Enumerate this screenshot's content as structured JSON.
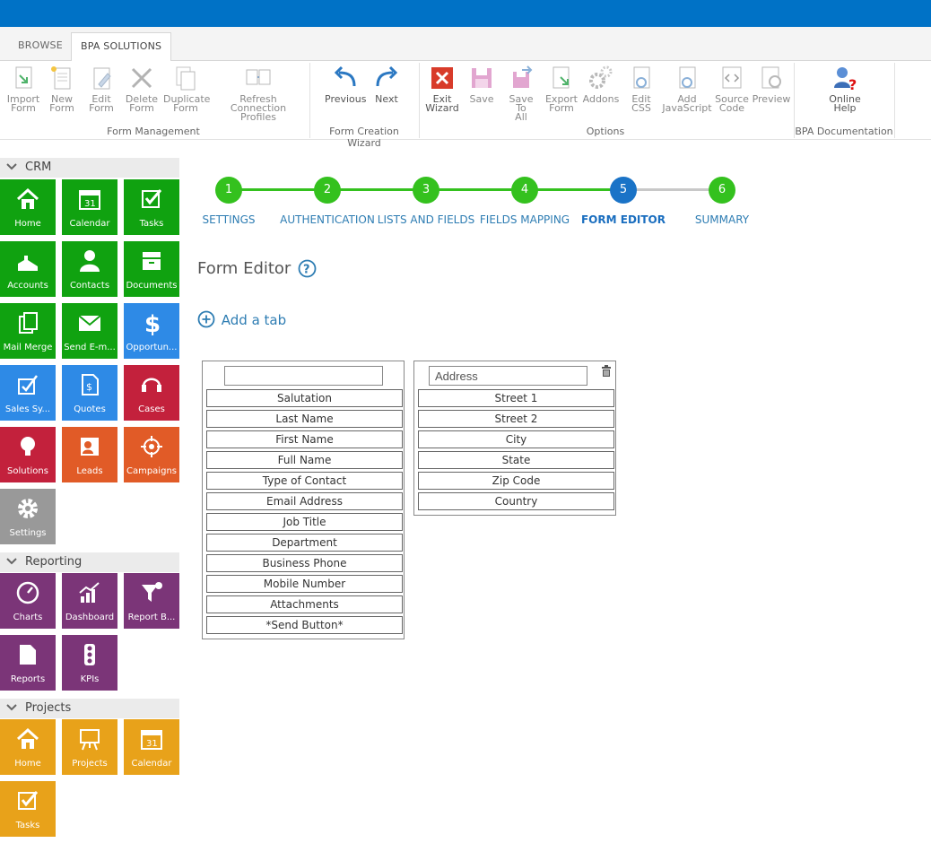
{
  "ribbon": {
    "tabs": [
      "BROWSE",
      "BPA SOLUTIONS"
    ],
    "buttons": {
      "import_form": "Import\nForm",
      "new_form": "New\nForm",
      "edit_form": "Edit\nForm",
      "delete_form": "Delete\nForm",
      "duplicate_form": "Duplicate\nForm",
      "refresh_profiles": "Refresh Connection\nProfiles",
      "previous": "Previous",
      "next": "Next",
      "exit_wizard": "Exit\nWizard",
      "save": "Save",
      "save_to_all": "Save To\nAll",
      "export_form": "Export\nForm",
      "addons": "Addons",
      "edit_css": "Edit\nCSS",
      "add_javascript": "Add\nJavaScript",
      "source_code": "Source\nCode",
      "preview": "Preview",
      "online_help": "Online\nHelp"
    },
    "groups": [
      "Form Management",
      "Form Creation Wizard",
      "Options",
      "BPA Documentation"
    ]
  },
  "sidebar": {
    "crm_label": "CRM",
    "crm_tiles": [
      "Home",
      "Calendar",
      "Tasks",
      "Accounts",
      "Contacts",
      "Documents",
      "Mail Merge",
      "Send E-m...",
      "Opportun...",
      "Sales Sy...",
      "Quotes",
      "Cases",
      "Solutions",
      "Leads",
      "Campaigns",
      "Settings"
    ],
    "reporting_label": "Reporting",
    "reporting_tiles": [
      "Charts",
      "Dashboard",
      "Report B...",
      "Reports",
      "KPIs"
    ],
    "projects_label": "Projects",
    "projects_tiles": [
      "Home",
      "Projects",
      "Calendar",
      "Tasks"
    ]
  },
  "wizard": {
    "steps": [
      {
        "num": "1",
        "label": "SETTINGS"
      },
      {
        "num": "2",
        "label": "AUTHENTICATION"
      },
      {
        "num": "3",
        "label": "LISTS AND FIELDS"
      },
      {
        "num": "4",
        "label": "FIELDS MAPPING"
      },
      {
        "num": "5",
        "label": "FORM EDITOR"
      },
      {
        "num": "6",
        "label": "SUMMARY"
      }
    ],
    "active_step": 5
  },
  "editor": {
    "title": "Form Editor",
    "add_tab": "Add a tab",
    "tab1_name": "",
    "tab1_fields": [
      "Salutation",
      "Last Name",
      "First Name",
      "Full Name",
      "Type of Contact",
      "Email Address",
      "Job Title",
      "Department",
      "Business Phone",
      "Mobile Number",
      "Attachments",
      "*Send Button*"
    ],
    "tab2_name": "Address",
    "tab2_fields": [
      "Street 1",
      "Street 2",
      "City",
      "State",
      "Zip Code",
      "Country"
    ]
  },
  "colors": {
    "accent": "#0072c6",
    "step_done": "#34c11e",
    "step_active": "#1a73c7"
  }
}
